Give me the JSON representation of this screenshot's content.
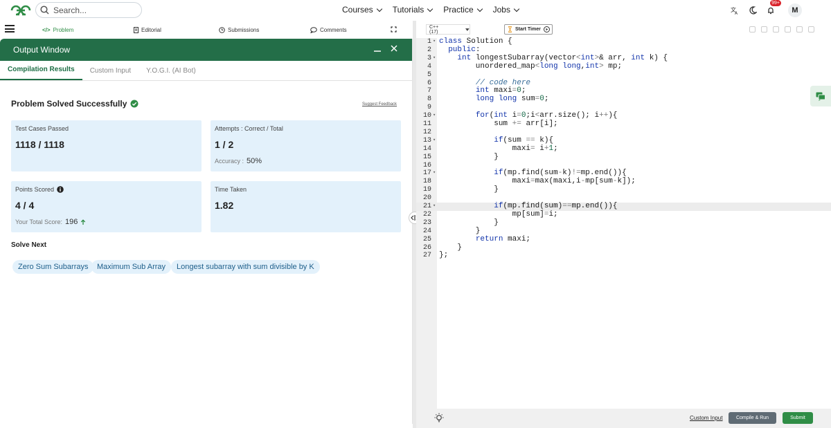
{
  "nav": {
    "search_placeholder": "Search...",
    "links": [
      "Courses",
      "Tutorials",
      "Practice",
      "Jobs"
    ],
    "notification_badge": "99+",
    "avatar_initial": "M"
  },
  "problem_tabs": {
    "problem": "Problem",
    "editorial": "Editorial",
    "submissions": "Submissions",
    "comments": "Comments"
  },
  "output": {
    "title": "Output Window",
    "tabs": [
      "Compilation Results",
      "Custom Input",
      "Y.O.G.I. (AI Bot)"
    ],
    "solved_text": "Problem Solved Successfully",
    "feedback": "Suggest Feedback",
    "cards": {
      "test_cases": {
        "label": "Test Cases Passed",
        "value": "1118 / 1118"
      },
      "attempts": {
        "label": "Attempts : Correct / Total",
        "value": "1 / 2",
        "sub_label": "Accuracy :",
        "sub_value": "50%"
      },
      "points": {
        "label": "Points Scored",
        "value": "4 / 4",
        "sub_label": "Your Total Score:",
        "sub_value": "196"
      },
      "time": {
        "label": "Time Taken",
        "value": "1.82"
      }
    },
    "solve_next": "Solve Next",
    "suggestions": [
      "Zero Sum Subarrays",
      "Maximum Sub Array",
      "Longest subarray with sum divisible by K"
    ]
  },
  "editor": {
    "language": "C++ (17)",
    "timer": "Start Timer",
    "highlighted_line": 21,
    "lines": [
      {
        "n": "1",
        "fold": true,
        "code": "class Solution {"
      },
      {
        "n": "2",
        "fold": false,
        "code": "  public:"
      },
      {
        "n": "3",
        "fold": true,
        "code": "    int longestSubarray(vector<int>& arr, int k) {"
      },
      {
        "n": "4",
        "fold": false,
        "code": "        unordered_map<long long,int> mp;"
      },
      {
        "n": "5",
        "fold": false,
        "code": ""
      },
      {
        "n": "6",
        "fold": false,
        "code": "        // code here"
      },
      {
        "n": "7",
        "fold": false,
        "code": "        int maxi=0;"
      },
      {
        "n": "8",
        "fold": false,
        "code": "        long long sum=0;"
      },
      {
        "n": "9",
        "fold": false,
        "code": ""
      },
      {
        "n": "10",
        "fold": true,
        "code": "        for(int i=0;i<arr.size(); i++){"
      },
      {
        "n": "11",
        "fold": false,
        "code": "            sum += arr[i];"
      },
      {
        "n": "12",
        "fold": false,
        "code": ""
      },
      {
        "n": "13",
        "fold": true,
        "code": "            if(sum == k){"
      },
      {
        "n": "14",
        "fold": false,
        "code": "                maxi= i+1;"
      },
      {
        "n": "15",
        "fold": false,
        "code": "            }"
      },
      {
        "n": "16",
        "fold": false,
        "code": ""
      },
      {
        "n": "17",
        "fold": true,
        "code": "            if(mp.find(sum-k)!=mp.end()){"
      },
      {
        "n": "18",
        "fold": false,
        "code": "                maxi=max(maxi,i-mp[sum-k]);"
      },
      {
        "n": "19",
        "fold": false,
        "code": "            }"
      },
      {
        "n": "20",
        "fold": false,
        "code": ""
      },
      {
        "n": "21",
        "fold": true,
        "code": "            if(mp.find(sum)==mp.end()){"
      },
      {
        "n": "22",
        "fold": false,
        "code": "                mp[sum]=i;"
      },
      {
        "n": "23",
        "fold": false,
        "code": "            }"
      },
      {
        "n": "24",
        "fold": false,
        "code": "        }"
      },
      {
        "n": "25",
        "fold": false,
        "code": "        return maxi;"
      },
      {
        "n": "26",
        "fold": false,
        "code": "    }"
      },
      {
        "n": "27",
        "fold": false,
        "code": "};"
      }
    ],
    "custom_input": "Custom Input",
    "compile_run": "Compile & Run",
    "submit": "Submit"
  },
  "colors": {
    "brand_green": "#2f8d46",
    "output_header": "#236e48",
    "card_bg": "#e3f1fb"
  }
}
